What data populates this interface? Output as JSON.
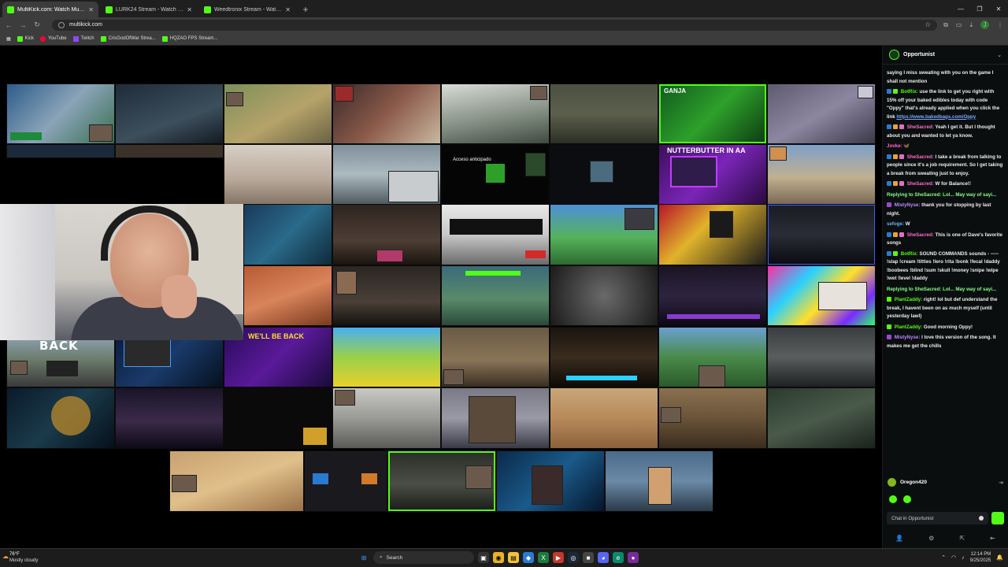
{
  "browser": {
    "tabs": [
      {
        "label": "MultiKick.com: Watch Multiple",
        "active": true
      },
      {
        "label": "LURK24 Stream - Watch Live on",
        "active": false
      },
      {
        "label": "Weedtronix Stream - Watch Live",
        "active": false
      }
    ],
    "new_tab": "+",
    "url": "multikick.com",
    "bookmarks": [
      "Kick",
      "YouTube",
      "Twitch",
      "CrisGodOfWar Strea...",
      "HQZAO FPS Stream..."
    ]
  },
  "grid": {
    "overlay_texts": [
      "BACK",
      "GANJA",
      "NUTTERBUTTER IN AA",
      "WE'LL BE BACK",
      "Acceso anticipado"
    ]
  },
  "chat": {
    "channel": "Opportunist",
    "messages": [
      {
        "user": "",
        "text": "saying I miss sweating with you on the game I shall not mention"
      },
      {
        "user": "BotRix:",
        "text": "use the link to get you right with 15% off your baked edibles today with code \"Oppy\" that's already applied when you click the link",
        "link": "https://www.bakedbags.com/Oppy"
      },
      {
        "user": "SheSacred:",
        "text": "Yeah I get it. But I thought about you and wanted to let ya know."
      },
      {
        "user": "Jovke:",
        "text": "🦋"
      },
      {
        "user": "SheSacred:",
        "text": "I take a break from talking to people since it's a job requirement. So I get taking a break from sweating just to enjoy."
      },
      {
        "user": "SheSacred:",
        "text": "W for Balance!!"
      },
      {
        "user": "",
        "reply": "Replying to SheSacred: Lol... May way of sayi..."
      },
      {
        "user": "MistyNyse:",
        "text": "thank you for stopping by last night."
      },
      {
        "user": "sefoge:",
        "text": "W"
      },
      {
        "user": "SheSacred:",
        "text": "This is one of Dave's favorite songs"
      },
      {
        "user": "BotRix:",
        "text": "SOUND COMMANDS sounds - ----- !slap !cream !titties !lero !rita !bonk !fecal !daddy !boobees !blind !sum !skull !money !snipe !wipe !wet !level !daddy"
      },
      {
        "user": "",
        "reply": "Replying to SheSacred: Lol... May way of sayi..."
      },
      {
        "user": "PlantZaddy:",
        "text": "right! lol but def understand the break, I havent been on as much myself (until yesterday lawl)"
      },
      {
        "user": "PlantZaddy:",
        "text": "Good morning Oppy!"
      },
      {
        "user": "MistyNyse:",
        "text": "I love this version of the song. It makes me get the chills"
      }
    ],
    "current_user": "Oregon420",
    "input_placeholder": "Chat in Opportunist"
  },
  "taskbar": {
    "weather_temp": "76°F",
    "weather_desc": "Mostly cloudy",
    "search_placeholder": "Search",
    "time": "12:14 PM",
    "date": "9/25/2025"
  },
  "colors": {
    "kick_green": "#53fc18",
    "chat_bg": "#0b0e0f"
  }
}
